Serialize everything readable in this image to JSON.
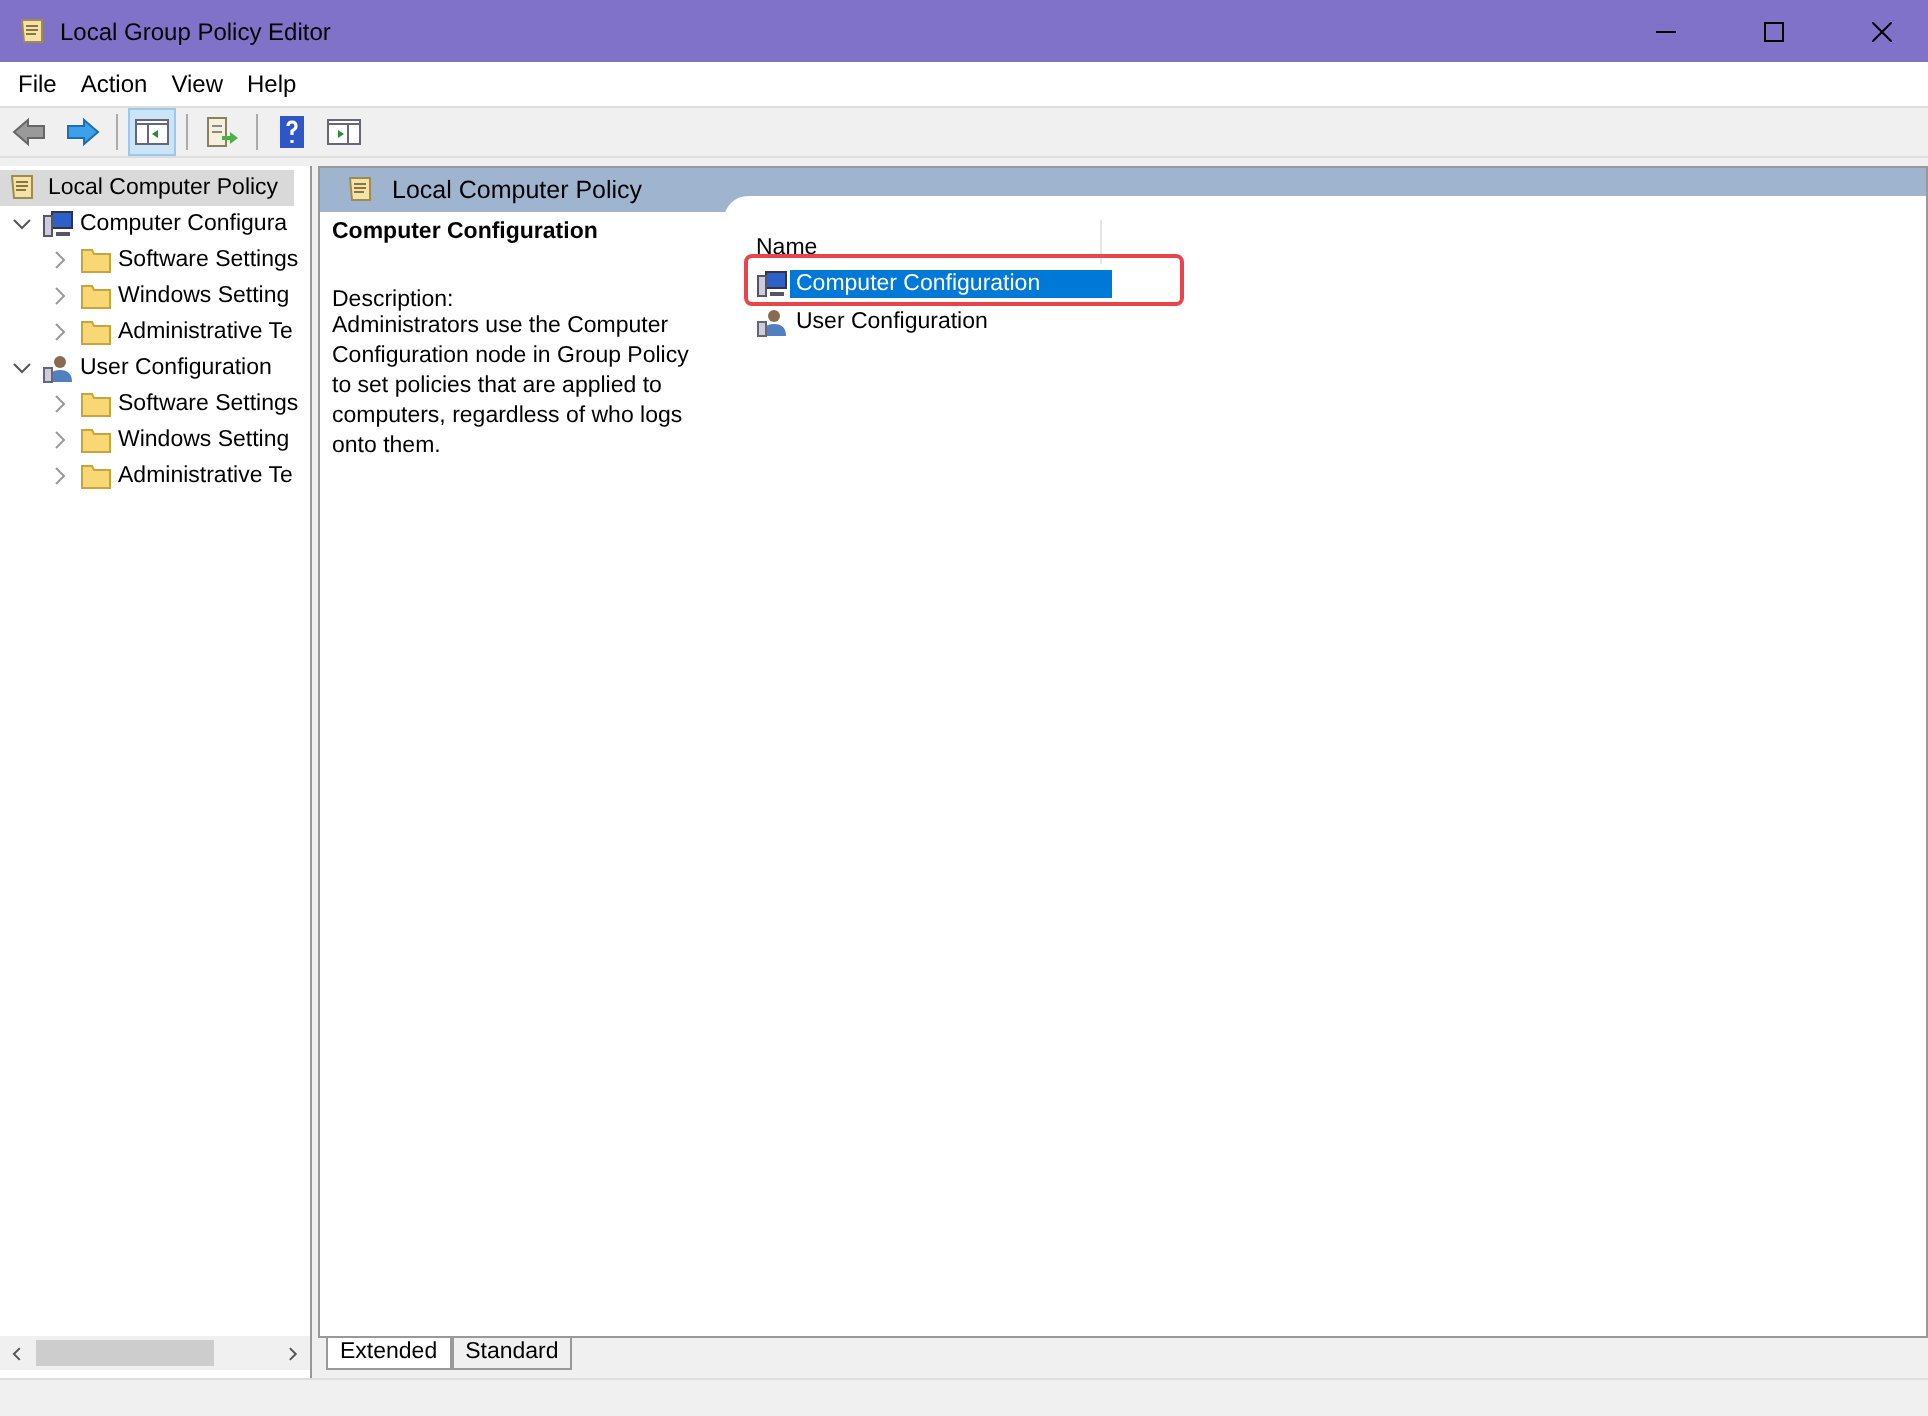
{
  "window": {
    "title": "Local Group Policy Editor"
  },
  "menu": [
    "File",
    "Action",
    "View",
    "Help"
  ],
  "toolbar": [
    {
      "kind": "back",
      "pressed": false
    },
    {
      "kind": "forward",
      "pressed": false
    },
    {
      "kind": "tree",
      "pressed": true
    },
    {
      "kind": "export",
      "pressed": false
    },
    {
      "kind": "help",
      "pressed": false
    },
    {
      "kind": "pane",
      "pressed": false
    }
  ],
  "tree": {
    "label": "Local Computer Policy",
    "selected": true,
    "children": [
      {
        "label": "Computer Configura",
        "kind": "computer",
        "expanded": true,
        "children": [
          {
            "label": "Software Settings",
            "kind": "folder",
            "expanded": false
          },
          {
            "label": "Windows Setting",
            "kind": "folder",
            "expanded": false
          },
          {
            "label": "Administrative Te",
            "kind": "folder",
            "expanded": false
          }
        ]
      },
      {
        "label": "User Configuration",
        "kind": "user",
        "expanded": true,
        "children": [
          {
            "label": "Software Settings",
            "kind": "folder",
            "expanded": false
          },
          {
            "label": "Windows Setting",
            "kind": "folder",
            "expanded": false
          },
          {
            "label": "Administrative Te",
            "kind": "folder",
            "expanded": false
          }
        ]
      }
    ]
  },
  "pane": {
    "header": "Local Computer Policy",
    "heading": "Computer Configuration",
    "description_label": "Description:",
    "description": "Administrators use the Computer Configuration node in Group Policy to set policies that are applied to computers, regardless of who logs onto them.",
    "column": "Name",
    "items": [
      {
        "label": "Computer Configuration",
        "kind": "computer",
        "selected": true,
        "highlighted": true
      },
      {
        "label": "User Configuration",
        "kind": "user",
        "selected": false,
        "highlighted": false
      }
    ]
  },
  "tabs": [
    {
      "label": "Extended",
      "selected": true
    },
    {
      "label": "Standard",
      "selected": false
    }
  ]
}
